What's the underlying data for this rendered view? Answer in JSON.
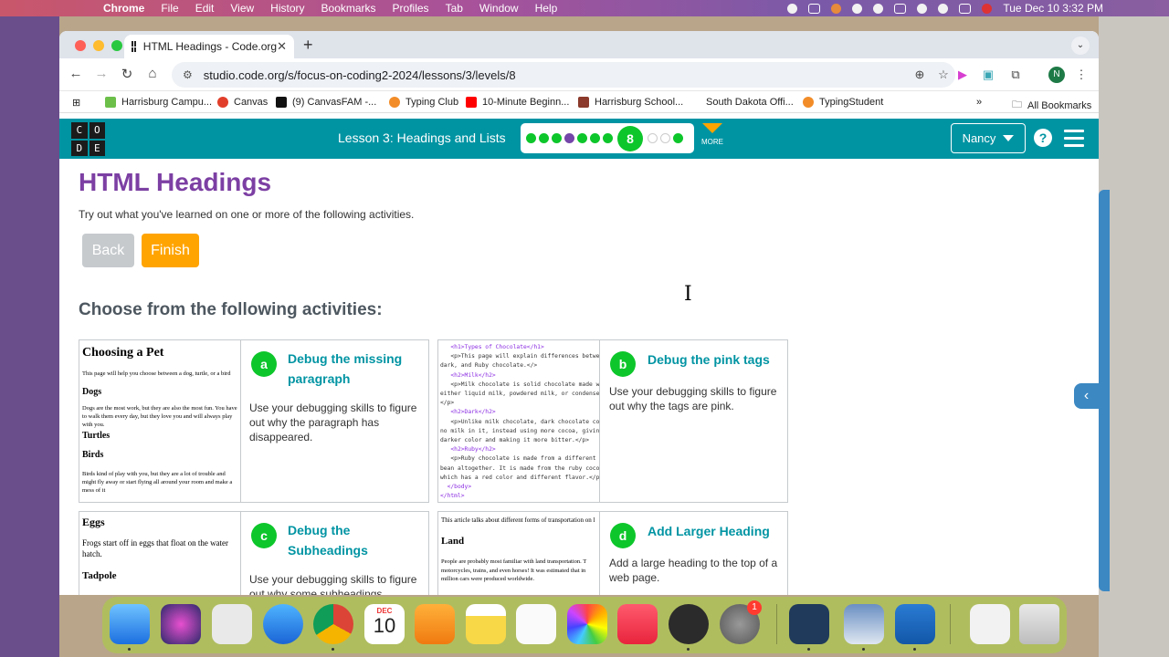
{
  "menubar": {
    "app": "Chrome",
    "items": [
      "File",
      "Edit",
      "View",
      "History",
      "Bookmarks",
      "Profiles",
      "Tab",
      "Window",
      "Help"
    ],
    "clock": "Tue Dec 10  3:32 PM"
  },
  "browser": {
    "tab_title": "HTML Headings - Code.org",
    "url": "studio.code.org/s/focus-on-coding2-2024/lessons/3/levels/8",
    "profile_initial": "N",
    "bookmarks": [
      {
        "label": "Harrisburg Campu...",
        "color": "#6cc04a"
      },
      {
        "label": "Canvas",
        "color": "#e13f2b"
      },
      {
        "label": "(9) CanvasFAM -...",
        "color": "#111111"
      },
      {
        "label": "Typing Club",
        "color": "#f28c28"
      },
      {
        "label": "10-Minute Beginn...",
        "color": "#ff0000"
      },
      {
        "label": "Harrisburg School...",
        "color": "#8b3a2b"
      },
      {
        "label": "South Dakota Offi...",
        "color": "#ffffff"
      },
      {
        "label": "TypingStudent",
        "color": "#f28c28"
      }
    ],
    "all_bookmarks": "All Bookmarks"
  },
  "codeorg": {
    "logo_letters": [
      "C",
      "O",
      "D",
      "E"
    ],
    "lesson_title": "Lesson 3: Headings and Lists",
    "current_level": "8",
    "more_label": "MORE",
    "user": "Nancy",
    "help": "?"
  },
  "page": {
    "title": "HTML Headings",
    "intro": "Try out what you've learned on one or more of the following activities.",
    "back": "Back",
    "finish": "Finish",
    "choose": "Choose from the following activities:"
  },
  "activities": [
    {
      "badge": "a",
      "title": "Debug the missing paragraph",
      "desc": "Use your debugging skills to figure out why the paragraph has disappeared.",
      "thumb": {
        "h": "Choosing a Pet",
        "p1": "This page will help you choose between a dog, turtle, or a bird",
        "h2a": "Dogs",
        "p2": "Dogs are the most work, but they are also the most fun. You have to walk them every day, but they love you and will always play with you.",
        "h2b": "Turtles",
        "h2c": "Birds",
        "p3": "Birds kind of play with you, but they are a lot of trouble and might fly away or start flying all around your room and make a mess of it"
      }
    },
    {
      "badge": "b",
      "title": "Debug the pink tags",
      "desc": "Use your debugging skills to figure out why the tags are pink.",
      "thumb_code": [
        "   <h1>Types of Chocolate</h1>",
        "   <p>This page will explain differences between milk,",
        "dark, and Ruby chocolate.</>",
        "   <h2>Milk</h2>",
        "   <p>Milk chocolate is solid chocolate made with",
        "either liquid milk, powdered milk, or condensed milk.",
        "</p>",
        "   <h2>Dark</h2>",
        "   <p>Unlike milk chocolate, dark chocolate contains",
        "no milk in it, instead using more cocoa, giving it a",
        "darker color and making it more bitter.</p>",
        "   <h2>Ruby</h2>",
        "   <p>Ruby chocolate is made from a different cocoa",
        "bean altogether. It is made from the ruby cocoa bean,",
        "which has a red color and different flavor.</p>.",
        "  </body>",
        "</html>"
      ]
    },
    {
      "badge": "c",
      "title": "Debug the Subheadings",
      "desc": "Use your debugging skills to figure out why some subheadings",
      "thumb": {
        "h": "Eggs",
        "p1": "Frogs start off in eggs that float on the water hatch.",
        "h2a": "Tadpole"
      }
    },
    {
      "badge": "d",
      "title": "Add Larger Heading",
      "desc": "Add a large heading to the top of a web page.",
      "thumb": {
        "p1": "This article talks about different forms of transportation on l",
        "h": "Land",
        "p2": "People are probably most familiar with land transportation. T motorcycles, trains, and even horses! It was estimated that in million cars were produced worldwide."
      }
    }
  ],
  "dock": {
    "calendar_month": "DEC",
    "calendar_day": "10",
    "settings_badge": "1"
  }
}
